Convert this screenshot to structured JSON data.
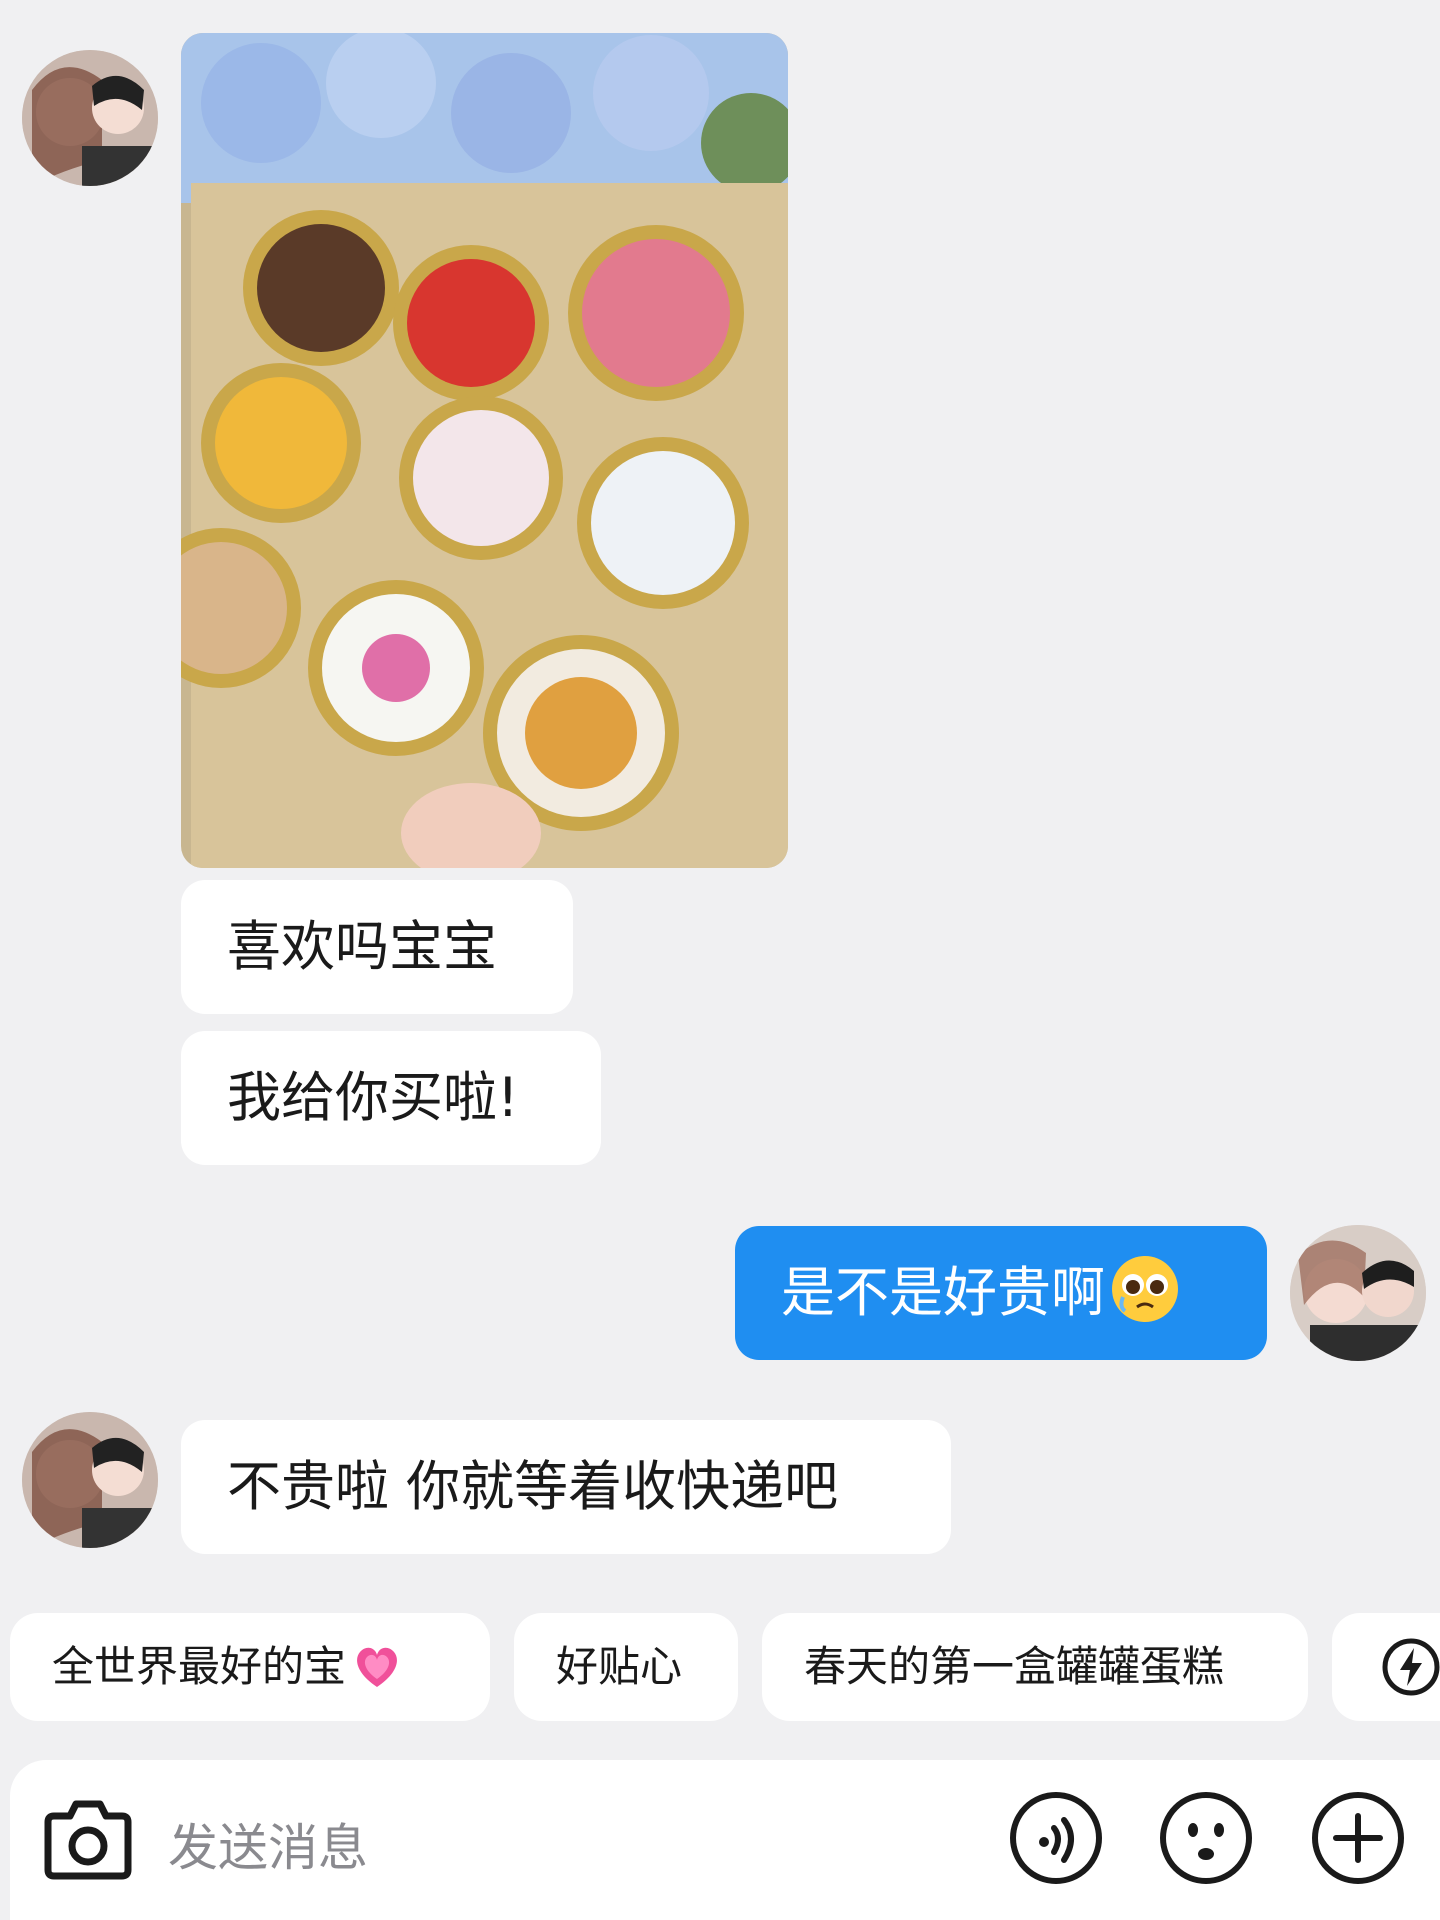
{
  "messages": [
    {
      "sender": "contact",
      "type": "image",
      "image_desc": "box of canned cakes"
    },
    {
      "sender": "contact",
      "type": "text",
      "text": "喜欢吗宝宝"
    },
    {
      "sender": "contact",
      "type": "text",
      "text": "我给你买啦!"
    },
    {
      "sender": "me",
      "type": "text",
      "text": "是不是好贵啊",
      "emoji": "pleading-face"
    },
    {
      "sender": "contact",
      "type": "text",
      "text": "不贵啦 你就等着收快递吧"
    }
  ],
  "quick_replies": [
    {
      "label": "全世界最好的宝",
      "emoji": "growing-heart"
    },
    {
      "label": "好贴心"
    },
    {
      "label": "春天的第一盒罐罐蛋糕"
    }
  ],
  "input": {
    "placeholder": "发送消息"
  },
  "icons": [
    "camera-icon",
    "voice-icon",
    "emoji-icon",
    "plus-icon",
    "lightning-icon"
  ],
  "colors": {
    "outgoing_bubble": "#1f8ef1",
    "background": "#f0f0f2"
  }
}
